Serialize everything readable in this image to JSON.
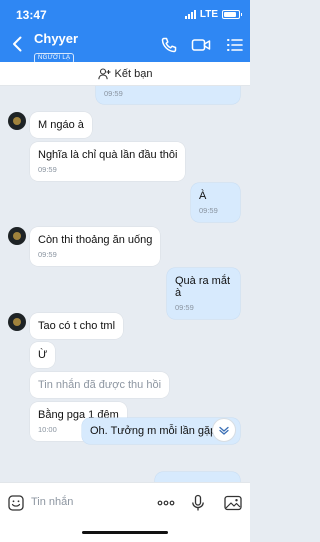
{
  "status": {
    "time": "13:47",
    "network": "LTE"
  },
  "header": {
    "name": "Chyyer",
    "badge": "NGƯỜI LẠ"
  },
  "friend_bar": {
    "label": "Kết bạn"
  },
  "messages": [
    {
      "time": "09:59"
    },
    {
      "text": "M ngáo à"
    },
    {
      "text": "Nghĩa là chỉ quà lần đầu thôi",
      "time": "09:59"
    },
    {
      "text": "À",
      "time": "09:59"
    },
    {
      "text": "Còn thi thoảng ăn uống",
      "time": "09:59"
    },
    {
      "text": "Quà ra mắt à",
      "time": "09:59"
    },
    {
      "text": "Tao có t cho tml"
    },
    {
      "text": "Ừ"
    },
    {
      "text": "Tin nhắn đã được thu hồi"
    },
    {
      "text": "Bằng pga 1 đêm",
      "time": "10:00"
    },
    {
      "text": "Oh. Tưởng m mỗi lần gặp lại"
    }
  ],
  "input": {
    "placeholder": "Tin nhắn"
  },
  "colors": {
    "brand": "#2f87f3",
    "my_bubble": "#d7eafd",
    "background": "#e7ecf2"
  }
}
